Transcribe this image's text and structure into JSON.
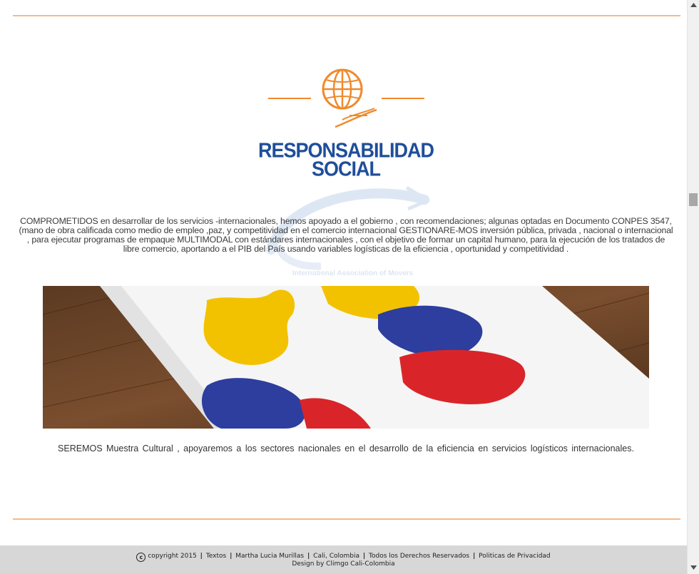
{
  "logo": {
    "title_line1": "RESPONSABILIDAD",
    "title_line2": "SOCIAL",
    "icon": "globe-hand-icon",
    "color": "#1f4e9a",
    "accent": "#f08a2c"
  },
  "watermark": {
    "text": "International Association of Movers"
  },
  "intro": {
    "text": "COMPROMETIDOS  en   desarrollar de los  servicios -internacionales,  hemos apoyado a el gobierno   , con     recomendaciones; algunas   optadas en Documento  CONPES  3547, (mano de  obra calificada como medio de empleo ,paz, y competitividad en el comercio internacional GESTIONARE-MOS  inversión pública, privada , nacional o internacional , para ejecutar  programas   de empaque  MULTIMODAL con estándares internacionales , con el objetivo de  formar  un capital humano,  para la ejecución de  los tratados de libre comercio, aportando a el PIB del País  usando  variables logísticas de la  eficiencia , oportunidad y competitividad   ."
  },
  "hero": {
    "image": "colombia-flag-map-image"
  },
  "caption": {
    "text": "SEREMOS    Muestra   Cultural  , apoyaremos a los sectores  nacionales   en  el desarrollo de la eficiencia  en  servicios  logísticos internacionales."
  },
  "footer": {
    "copyright": "copyright 2015",
    "items": [
      "Textos",
      "Martha Lucia Murillas",
      "Cali, Colombia",
      "Todos los Derechos Reservados",
      "Politicas de Privacidad"
    ],
    "design": "Design by Climgo Cali-Colombia"
  },
  "colors": {
    "divider": "#f6b98a",
    "footer_bg": "#d7d7d7"
  }
}
